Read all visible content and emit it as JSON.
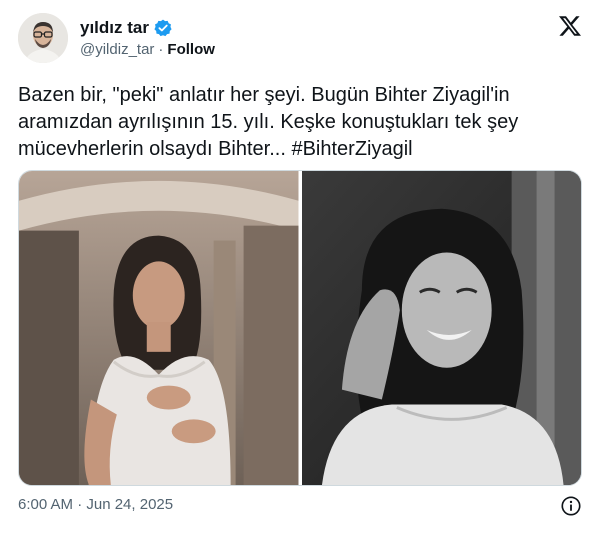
{
  "author": {
    "name": "yıldız tar",
    "handle": "@yildiz_tar",
    "separator": "·",
    "follow_label": "Follow",
    "verified_icon": "verified-badge-icon",
    "verified_color": "#1d9bf0"
  },
  "platform_icon": "x-logo-icon",
  "tweet": {
    "text": "Bazen bir, \"peki\" anlatır her şeyi. Bugün Bihter Ziyagil'in aramızdan ayrılışının 15. yılı. Keşke konuştukları tek şey mücevherlerin olsaydı Bihter... #BihterZiyagil"
  },
  "media": {
    "images": [
      {
        "description_icon": "photo-woman-white-dress-mirror"
      },
      {
        "description_icon": "photo-woman-black-and-white-smiling"
      }
    ]
  },
  "footer": {
    "timestamp": "6:00 AM · Jun 24, 2025",
    "info_icon": "info-icon"
  }
}
